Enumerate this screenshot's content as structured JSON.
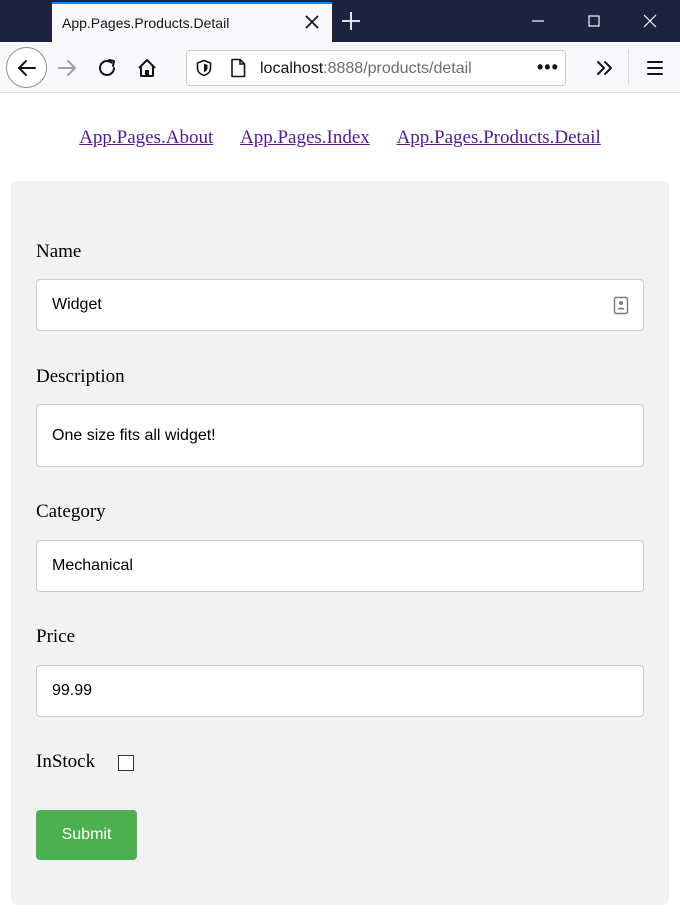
{
  "browser": {
    "tab_title": "App.Pages.Products.Detail",
    "url_host": "localhost",
    "url_rest": ":8888/products/detail",
    "url_more": "•••",
    "accent_color": "#0a84ff",
    "titlebar_color": "#1d2241"
  },
  "nav_links": [
    {
      "label": "App.Pages.About"
    },
    {
      "label": "App.Pages.Index"
    },
    {
      "label": "App.Pages.Products.Detail"
    }
  ],
  "form": {
    "name": {
      "label": "Name",
      "value": "Widget"
    },
    "description": {
      "label": "Description",
      "value": "One size fits all widget!"
    },
    "category": {
      "label": "Category",
      "value": "Mechanical"
    },
    "price": {
      "label": "Price",
      "value": "99.99"
    },
    "in_stock": {
      "label": "InStock",
      "checked": false
    },
    "submit_label": "Submit",
    "submit_color": "#4caf50"
  }
}
